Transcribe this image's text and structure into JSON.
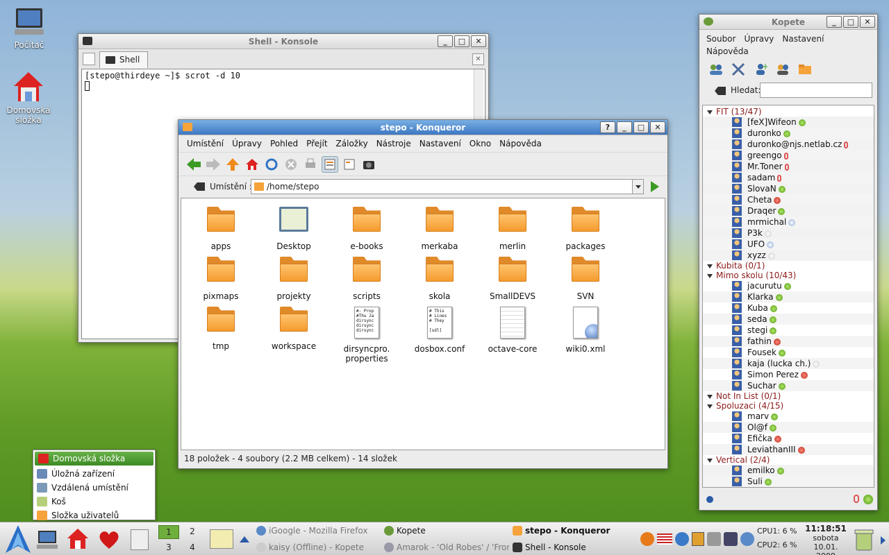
{
  "desktop": {
    "icons": [
      {
        "label": "Počítač"
      },
      {
        "label": "Domovská složka"
      }
    ]
  },
  "konsole": {
    "title": "Shell - Konsole",
    "tab": "Shell",
    "lines": [
      "[stepo@thirdeye ~]$ scrot -d 10"
    ]
  },
  "konqueror": {
    "title": "stepo - Konqueror",
    "menu": [
      "Umístění",
      "Úpravy",
      "Pohled",
      "Přejít",
      "Záložky",
      "Nástroje",
      "Nastavení",
      "Okno",
      "Nápověda"
    ],
    "location_label": "Umístění :",
    "location_value": "/home/stepo",
    "files": [
      {
        "name": "apps",
        "type": "folder"
      },
      {
        "name": "Desktop",
        "type": "desktop"
      },
      {
        "name": "e-books",
        "type": "folder"
      },
      {
        "name": "merkaba",
        "type": "folder"
      },
      {
        "name": "merlin",
        "type": "folder"
      },
      {
        "name": "packages",
        "type": "folder"
      },
      {
        "name": "pixmaps",
        "type": "folder"
      },
      {
        "name": "projekty",
        "type": "folder"
      },
      {
        "name": "scripts",
        "type": "folder"
      },
      {
        "name": "skola",
        "type": "folder"
      },
      {
        "name": "SmallDEVS",
        "type": "folder"
      },
      {
        "name": "SVN",
        "type": "folder"
      },
      {
        "name": "tmp",
        "type": "folder"
      },
      {
        "name": "workspace",
        "type": "folder"
      },
      {
        "name": "dirsyncpro.\nproperties",
        "type": "text",
        "preview": "#- Prop\n#Thu Ja\ndirsync\ndirsync\ndirsync"
      },
      {
        "name": "dosbox.conf",
        "type": "text",
        "preview": "# This\n# Lines\n# They\n\n[sdl]"
      },
      {
        "name": "octave-core",
        "type": "blank"
      },
      {
        "name": "wiki0.xml",
        "type": "xml"
      }
    ],
    "status": "18 položek - 4 soubory (2.2 MB celkem) - 14 složek"
  },
  "kopete": {
    "title": "Kopete",
    "menu": [
      "Soubor",
      "Úpravy",
      "Nastavení",
      "Nápověda"
    ],
    "search_label": "Hledat:",
    "search_value": "",
    "groups": [
      {
        "name": "FIT (13/47)",
        "contacts": [
          {
            "name": "[feX]Wifeon",
            "status": "online"
          },
          {
            "name": "duronko",
            "status": "online"
          },
          {
            "name": "duronko@njs.netlab.cz",
            "status": "phone"
          },
          {
            "name": "greengo",
            "status": "phone"
          },
          {
            "name": "Mr.Toner",
            "status": "phone"
          },
          {
            "name": "sadam",
            "status": "phone"
          },
          {
            "name": "SlovaN",
            "status": "online"
          },
          {
            "name": "Cheta",
            "status": "busy"
          },
          {
            "name": "Draqer",
            "status": "online"
          },
          {
            "name": "mrmichal",
            "status": "away"
          },
          {
            "name": "P3k",
            "status": "offline"
          },
          {
            "name": "UFO",
            "status": "away"
          },
          {
            "name": "xyzz",
            "status": "offline"
          }
        ]
      },
      {
        "name": "Kubita (0/1)",
        "contacts": []
      },
      {
        "name": "Mimo skolu (10/43)",
        "contacts": [
          {
            "name": "jacurutu",
            "status": "online"
          },
          {
            "name": "Klarka",
            "status": "online"
          },
          {
            "name": "Kuba",
            "status": "online"
          },
          {
            "name": "seda",
            "status": "online"
          },
          {
            "name": "stegi",
            "status": "online"
          },
          {
            "name": "fathin",
            "status": "busy"
          },
          {
            "name": "Fousek",
            "status": "online"
          },
          {
            "name": "kaja (lucka ch.)",
            "status": "offline"
          },
          {
            "name": "Simon Perez",
            "status": "busy"
          },
          {
            "name": "Suchar",
            "status": "online"
          }
        ]
      },
      {
        "name": "Not In List (0/1)",
        "contacts": []
      },
      {
        "name": "Spoluzaci (4/15)",
        "contacts": [
          {
            "name": "marv",
            "status": "online"
          },
          {
            "name": "Ol@f",
            "status": "online"
          },
          {
            "name": "Efička",
            "status": "busy"
          },
          {
            "name": "LeviathanIII",
            "status": "busy"
          }
        ]
      },
      {
        "name": "Vertical (2/4)",
        "contacts": [
          {
            "name": "emilko",
            "status": "online"
          },
          {
            "name": "Suli",
            "status": "online"
          }
        ]
      }
    ]
  },
  "places_popup": {
    "items": [
      "Domovská složka",
      "Úložná zařízení",
      "Vzdálená umístění",
      "Koš",
      "Složka uživatelů"
    ],
    "selected": 0
  },
  "panel": {
    "pager": [
      "1",
      "2",
      "3",
      "4"
    ],
    "tasks": [
      {
        "label": "iGoogle - Mozilla Firefox",
        "dim": true
      },
      {
        "label": "kaisy (Offline) - Kopete",
        "dim": true
      },
      {
        "label": "Kopete",
        "dim": false
      },
      {
        "label": "Amarok - 'Old Robes' / 'From",
        "dim": true
      },
      {
        "label": "stepo - Konqueror",
        "dim": false,
        "bold": true
      },
      {
        "label": "Shell - Konsole",
        "dim": false
      }
    ],
    "cpu1": "CPU1: 6 %",
    "cpu2": "CPU2: 6 %",
    "time": "11:18:51",
    "day": "sobota",
    "date": "10.01. 2009"
  }
}
